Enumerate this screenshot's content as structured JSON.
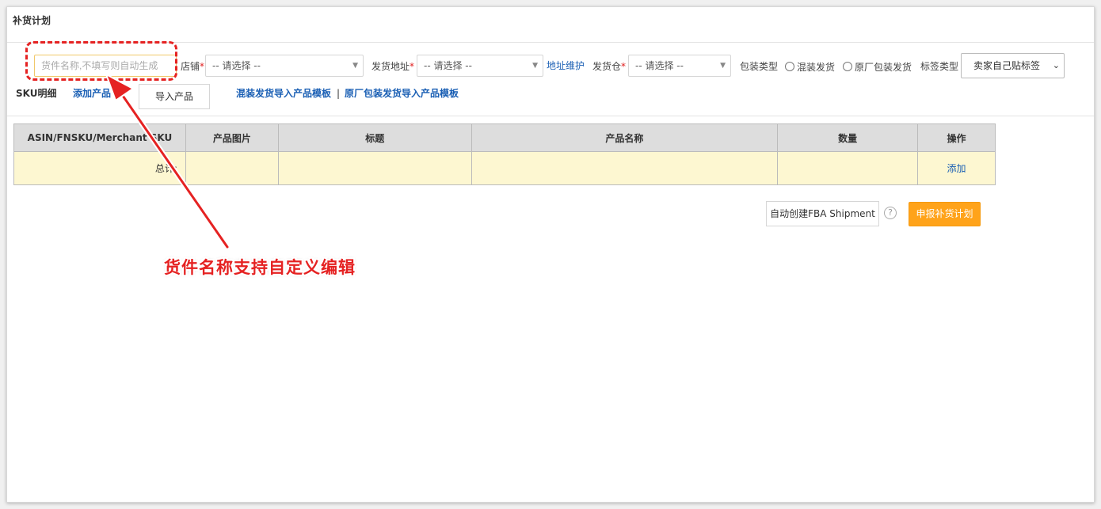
{
  "page": {
    "title": "补货计划"
  },
  "form": {
    "shipment_name_placeholder": "货件名称,不填写则自动生成",
    "shop_label": "店铺",
    "shop_select": "-- 请选择 --",
    "address_label": "发货地址",
    "address_select": "-- 请选择 --",
    "address_link": "地址维护",
    "warehouse_label": "发货仓",
    "warehouse_select": "-- 请选择 --",
    "pack_type_label": "包装类型",
    "pack_option_mixed": "混装发货",
    "pack_option_original": "原厂包装发货",
    "label_type_label": "标签类型",
    "label_type_select": "卖家自己贴标签",
    "required_mark": "*"
  },
  "sku_section": {
    "title": "SKU明细",
    "add_product": "添加产品",
    "import_button": "导入产品",
    "mixed_template_link": "混装发货导入产品模板",
    "separator": "|",
    "original_template_link": "原厂包装发货导入产品模板"
  },
  "table": {
    "headers": [
      "ASIN/FNSKU/Merchant SKU",
      "产品图片",
      "标题",
      "产品名称",
      "数量",
      "操作"
    ],
    "total_row": {
      "label": "总计:",
      "action": "添加"
    }
  },
  "actions": {
    "auto_create": "自动创建FBA Shipment",
    "help_icon": "question-circle-icon",
    "submit": "申报补货计划"
  },
  "annotation": {
    "text": "货件名称支持自定义编辑",
    "color": "#e52222"
  },
  "colors": {
    "link": "#1a5fb4",
    "primary": "#ffa31a",
    "total_row_bg": "#fdf7d1"
  }
}
